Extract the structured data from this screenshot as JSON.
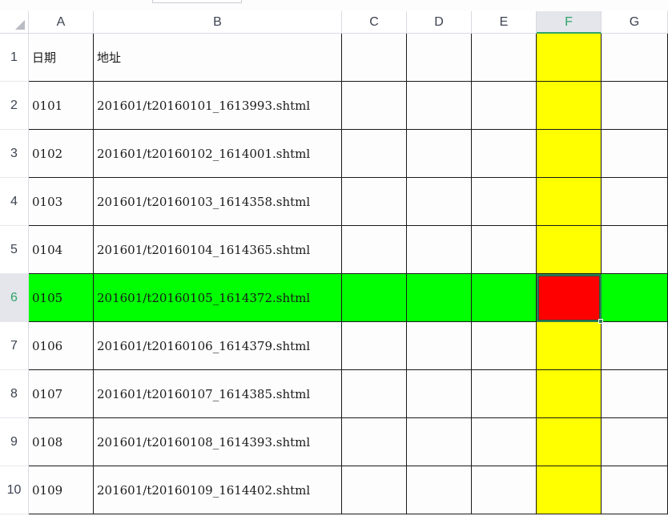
{
  "columns": [
    "A",
    "B",
    "C",
    "D",
    "E",
    "F",
    "G"
  ],
  "rows": [
    {
      "num": "1",
      "a": "日期",
      "b": "地址"
    },
    {
      "num": "2",
      "a": "0101",
      "b": "201601/t20160101_1613993.shtml"
    },
    {
      "num": "3",
      "a": "0102",
      "b": "201601/t20160102_1614001.shtml"
    },
    {
      "num": "4",
      "a": "0103",
      "b": "201601/t20160103_1614358.shtml"
    },
    {
      "num": "5",
      "a": "0104",
      "b": "201601/t20160104_1614365.shtml"
    },
    {
      "num": "6",
      "a": "0105",
      "b": "201601/t20160105_1614372.shtml"
    },
    {
      "num": "7",
      "a": "0106",
      "b": "201601/t20160106_1614379.shtml"
    },
    {
      "num": "8",
      "a": "0107",
      "b": "201601/t20160107_1614385.shtml"
    },
    {
      "num": "9",
      "a": "0108",
      "b": "201601/t20160108_1614393.shtml"
    },
    {
      "num": "10",
      "a": "0109",
      "b": "201601/t20160109_1614402.shtml"
    }
  ],
  "active_cell": {
    "column": "F",
    "row": "6"
  },
  "colors": {
    "column_highlight": "#ffff00",
    "row_highlight": "#00ff00",
    "active_cell_fill": "#ff0000",
    "active_header_text": "#2ea36a"
  },
  "icons": {
    "select_all": "select-all-triangle-icon"
  }
}
